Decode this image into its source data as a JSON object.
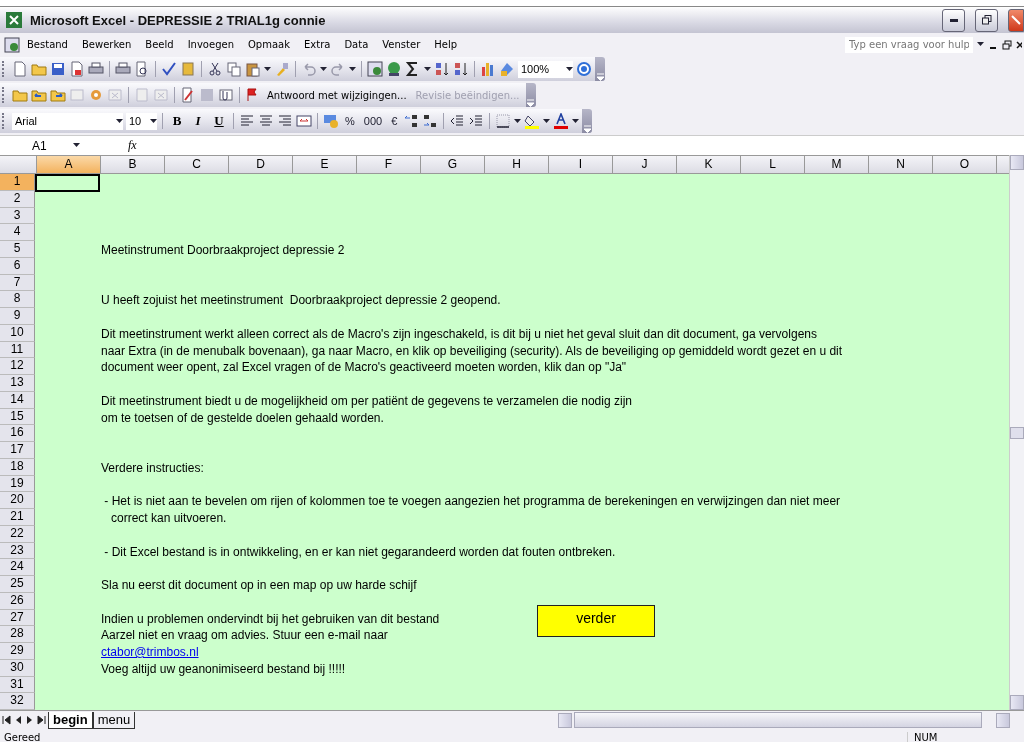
{
  "window": {
    "title": "Microsoft Excel - DEPRESSIE 2 TRIAL1g connie"
  },
  "menu": [
    "Bestand",
    "Bewerken",
    "Beeld",
    "Invoegen",
    "Opmaak",
    "Extra",
    "Data",
    "Venster",
    "Help"
  ],
  "help_field": {
    "placeholder": "Typ een vraag voor hulp"
  },
  "standard_toolbar": {
    "zoom": "100%"
  },
  "reviewing_toolbar": {
    "buttons": [
      {
        "label": "Antwoord met wijzigingen...",
        "disabled": false
      },
      {
        "label": "Revisie beëindigen...",
        "disabled": true
      }
    ]
  },
  "formatting_toolbar": {
    "font": "Arial",
    "size": "10",
    "style_buttons": [
      "B",
      "I",
      "U"
    ],
    "number_buttons": [
      "%",
      "000",
      "€"
    ]
  },
  "formula_bar": {
    "name_box": "A1",
    "fx": "fx"
  },
  "columns": [
    {
      "label": "A",
      "selected": true
    },
    {
      "label": "B",
      "selected": false
    },
    {
      "label": "C",
      "selected": false
    },
    {
      "label": "D",
      "selected": false
    },
    {
      "label": "E",
      "selected": false
    },
    {
      "label": "F",
      "selected": false
    },
    {
      "label": "G",
      "selected": false
    },
    {
      "label": "H",
      "selected": false
    },
    {
      "label": "I",
      "selected": false
    },
    {
      "label": "J",
      "selected": false
    },
    {
      "label": "K",
      "selected": false
    },
    {
      "label": "L",
      "selected": false
    },
    {
      "label": "M",
      "selected": false
    },
    {
      "label": "N",
      "selected": false
    },
    {
      "label": "O",
      "selected": false
    }
  ],
  "rows": [
    {
      "number": "1",
      "selected": true
    },
    {
      "number": "2",
      "selected": false
    },
    {
      "number": "3",
      "selected": false
    },
    {
      "number": "4",
      "selected": false
    },
    {
      "number": "5",
      "selected": false,
      "text": "Meetinstrument Doorbraakproject depressie 2"
    },
    {
      "number": "6",
      "selected": false
    },
    {
      "number": "7",
      "selected": false
    },
    {
      "number": "8",
      "selected": false,
      "text": "U heeft zojuist het meetinstrument  Doorbraakproject depressie 2 geopend."
    },
    {
      "number": "9",
      "selected": false
    },
    {
      "number": "10",
      "selected": false,
      "text": "Dit meetinstrument werkt alleen correct als de Macro's zijn ingeschakeld, is dit bij u niet het geval sluit dan dit document, ga vervolgens"
    },
    {
      "number": "11",
      "selected": false,
      "text": "naar Extra (in de menubalk bovenaan), ga naar Macro, en klik op beveiliging (security). Als de beveiliging op gemiddeld wordt gezet en u dit"
    },
    {
      "number": "12",
      "selected": false,
      "text": "document weer opent, zal Excel vragen of de Macro's geactiveerd moeten worden, klik dan op \"Ja\""
    },
    {
      "number": "13",
      "selected": false
    },
    {
      "number": "14",
      "selected": false,
      "text": "Dit meetinstrument biedt u de mogelijkheid om per patiënt de gegevens te verzamelen die nodig zijn"
    },
    {
      "number": "15",
      "selected": false,
      "text": "om te toetsen of de gestelde doelen gehaald worden."
    },
    {
      "number": "16",
      "selected": false
    },
    {
      "number": "17",
      "selected": false
    },
    {
      "number": "18",
      "selected": false,
      "text": "Verdere instructies:"
    },
    {
      "number": "19",
      "selected": false
    },
    {
      "number": "20",
      "selected": false,
      "text": " - Het is niet aan te bevelen om rijen of kolommen toe te voegen aangezien het programma de berekeningen en verwijzingen dan niet meer"
    },
    {
      "number": "21",
      "selected": false,
      "text": "   correct kan uitvoeren."
    },
    {
      "number": "22",
      "selected": false
    },
    {
      "number": "23",
      "selected": false,
      "text": " - Dit Excel bestand is in ontwikkeling, en er kan niet gegarandeerd worden dat fouten ontbreken."
    },
    {
      "number": "24",
      "selected": false
    },
    {
      "number": "25",
      "selected": false,
      "text": "Sla nu eerst dit document op in een map op uw harde schijf"
    },
    {
      "number": "26",
      "selected": false
    },
    {
      "number": "27",
      "selected": false,
      "text": "Indien u problemen ondervindt bij het gebruiken van dit bestand"
    },
    {
      "number": "28",
      "selected": false,
      "text": "Aarzel niet en vraag om advies. Stuur een e-mail naar"
    },
    {
      "number": "29",
      "selected": false,
      "text": "ctabor@trimbos.nl",
      "kind": "link"
    },
    {
      "number": "30",
      "selected": false,
      "text": "Voeg altijd uw geanonimiseerd bestand bij !!!!!"
    },
    {
      "number": "31",
      "selected": false
    },
    {
      "number": "32",
      "selected": false
    }
  ],
  "sheet_button": {
    "label": "verder"
  },
  "sheet_tabs": [
    {
      "label": "begin",
      "selected": true
    },
    {
      "label": "menu",
      "selected": false
    }
  ],
  "status_bar": {
    "left": "Gereed",
    "right": "NUM"
  }
}
